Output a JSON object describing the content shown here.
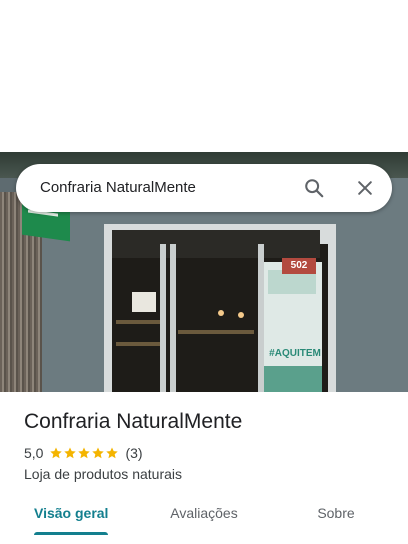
{
  "search": {
    "query": "Confraria NaturalMente",
    "search_icon": "search-icon",
    "close_icon": "close-icon"
  },
  "photo": {
    "sign_red": "502",
    "poster_text": "#AQUITEM"
  },
  "place": {
    "name": "Confraria NaturalMente",
    "rating": "5,0",
    "stars": 5,
    "review_count": "(3)",
    "category": "Loja de produtos naturais"
  },
  "tabs": [
    {
      "label": "Visão geral",
      "active": true
    },
    {
      "label": "Avaliações",
      "active": false
    },
    {
      "label": "Sobre",
      "active": false
    }
  ],
  "colors": {
    "accent": "#137f8e",
    "star": "#f4b400"
  }
}
